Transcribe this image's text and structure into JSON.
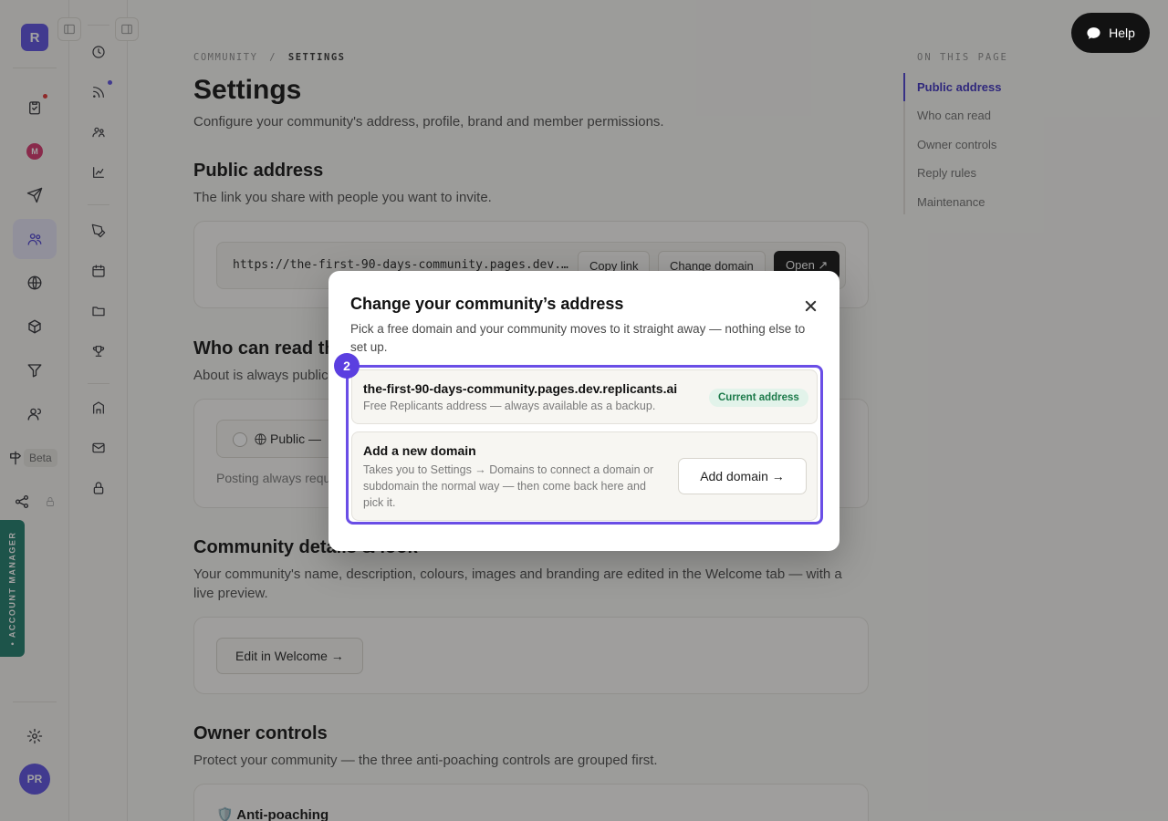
{
  "app": {
    "logo_letter": "R",
    "avatar_initials": "PR",
    "beta_label": "Beta",
    "account_manager_label": "• ACCOUNT MANAGER",
    "help_label": "Help"
  },
  "page": {
    "breadcrumb_parent": "COMMUNITY",
    "breadcrumb_separator": "/",
    "breadcrumb_current": "SETTINGS",
    "title": "Settings",
    "subtitle": "Configure your community's address, profile, brand and member permissions."
  },
  "public_address": {
    "heading": "Public address",
    "description": "The link you share with people you want to invite.",
    "url": "https://the-first-90-days-community.pages.dev.replicants.ai",
    "copy_label": "Copy link",
    "change_label": "Change domain",
    "open_label": "Open ↗"
  },
  "who_can_read": {
    "heading": "Who can read this",
    "description": "About is always public",
    "option_label": "Public —",
    "note": "Posting always requ"
  },
  "details": {
    "heading": "Community details & look",
    "description_line1": "Your community's name, description, colours, images and branding are edited in the Welcome tab — with a",
    "description_line2": "live preview.",
    "edit_label": "Edit in Welcome →"
  },
  "owner_controls": {
    "heading": "Owner controls",
    "description": "Protect your community — the three anti-poaching controls are grouped first.",
    "anti_poaching": "🛡️ Anti-poaching"
  },
  "toc": {
    "title": "ON THIS PAGE",
    "items": [
      "Public address",
      "Who can read",
      "Owner controls",
      "Reply rules",
      "Maintenance"
    ],
    "active_index": 0
  },
  "modal": {
    "title": "Change your community’s address",
    "description": "Pick a free domain and your community moves to it straight away — nothing else to set up.",
    "step_number": "2",
    "current_option": {
      "title": "the-first-90-days-community.pages.dev.replicants.ai",
      "subtitle": "Free Replicants address — always available as a backup.",
      "badge": "Current address"
    },
    "new_option": {
      "title": "Add a new domain",
      "description": "Takes you to Settings → Domains to connect a domain or subdomain the normal way — then come back here and pick it.",
      "button": "Add domain →"
    }
  },
  "colors": {
    "accent": "#5b4fe0",
    "highlight": "#6a4ee6",
    "success_bg": "#e2f3ea",
    "success_text": "#1c7a4a",
    "account_tab": "#1d7a69"
  }
}
